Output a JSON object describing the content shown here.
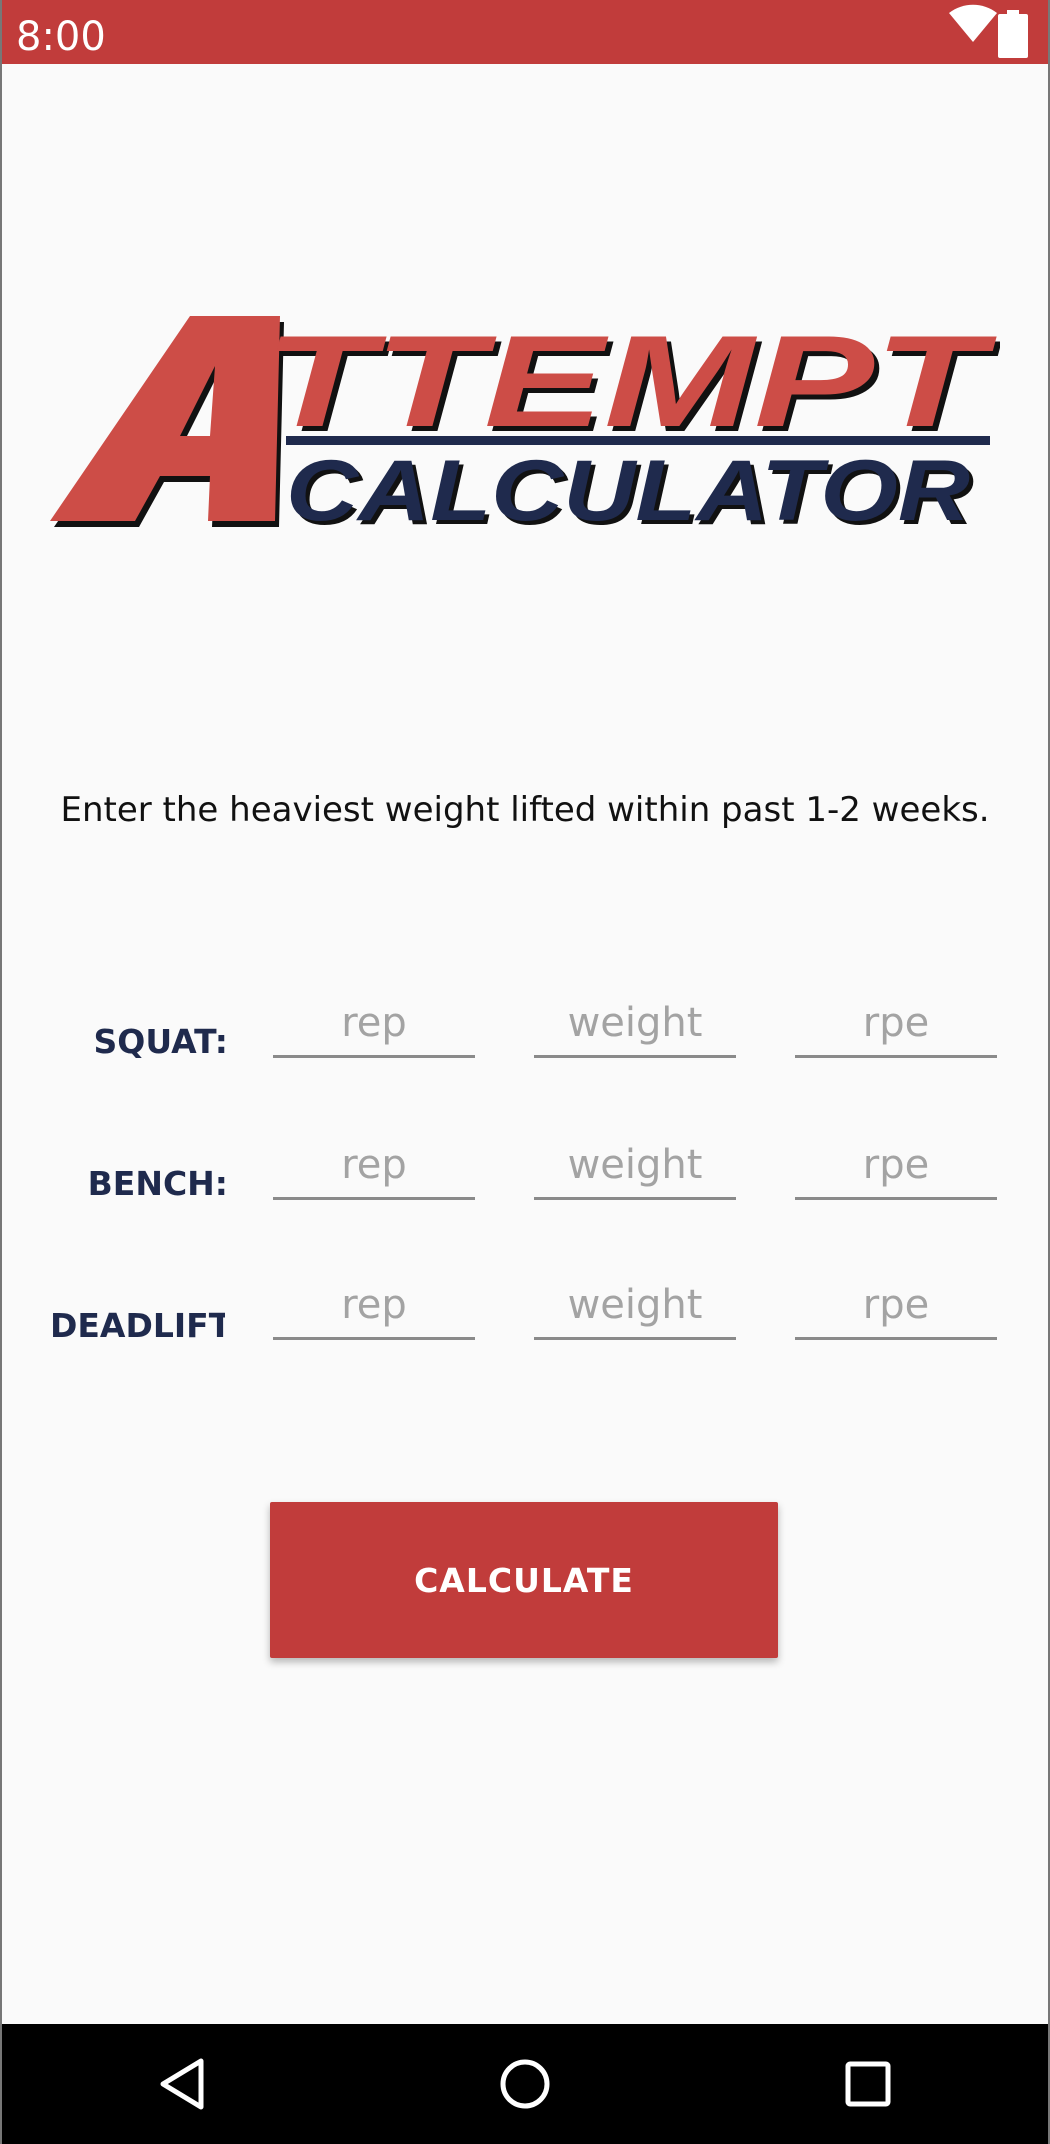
{
  "status_bar": {
    "time": "8:00",
    "color": "#c13c3b",
    "icons": [
      "wifi-icon",
      "battery-icon"
    ]
  },
  "logo": {
    "word_top": "TTEMPT",
    "big_letter": "A",
    "word_bottom": "CALCULATOR",
    "colors": {
      "red": "#cd4d47",
      "navy": "#1f2a4d"
    }
  },
  "instruction": "Enter the heaviest weight lifted within past 1-2 weeks.",
  "lifts": [
    {
      "label": "SQUAT:",
      "fields": {
        "rep": "rep",
        "weight": "weight",
        "rpe": "rpe"
      }
    },
    {
      "label": "BENCH:",
      "fields": {
        "rep": "rep",
        "weight": "weight",
        "rpe": "rpe"
      }
    },
    {
      "label": "DEADLIFT:",
      "fields": {
        "rep": "rep",
        "weight": "weight",
        "rpe": "rpe"
      }
    }
  ],
  "calculate_button": {
    "label": "CALCULATE",
    "color": "#c13c3b"
  },
  "nav_bar": {
    "buttons": [
      "back-icon",
      "home-icon",
      "recents-icon"
    ]
  }
}
